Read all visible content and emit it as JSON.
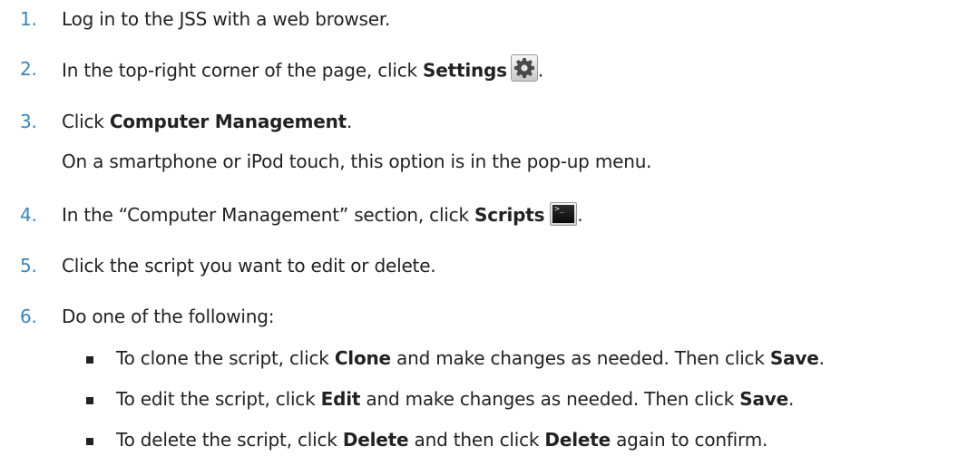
{
  "steps": [
    {
      "number": "1.",
      "text": "Log in to the JSS with a web browser."
    },
    {
      "number": "2.",
      "pre": "In the top-right corner of the page, click ",
      "bold": "Settings",
      "post": ".",
      "icon": "gear-icon"
    },
    {
      "number": "3.",
      "pre": "Click ",
      "bold": "Computer Management",
      "post": ".",
      "note": "On a smartphone or iPod touch, this option is in the pop-up menu."
    },
    {
      "number": "4.",
      "pre": "In the “Computer Management” section, click ",
      "bold": "Scripts",
      "post": ".",
      "icon": "terminal-icon",
      "icon_text": ">_"
    },
    {
      "number": "5.",
      "text": "Click the script you want to edit or delete."
    },
    {
      "number": "6.",
      "text": "Do one of the following:"
    }
  ],
  "options": [
    {
      "a": "To clone the script, click ",
      "b1": "Clone",
      "c": " and make changes as needed. Then click ",
      "b2": "Save",
      "d": "."
    },
    {
      "a": "To edit the script, click ",
      "b1": "Edit",
      "c": " and make changes as needed. Then click ",
      "b2": "Save",
      "d": "."
    },
    {
      "a": "To delete the script, click ",
      "b1": "Delete",
      "c": " and then click ",
      "b2": "Delete",
      "d": " again to confirm."
    }
  ],
  "colors": {
    "step_number": "#3b86b5",
    "text": "#222222"
  }
}
